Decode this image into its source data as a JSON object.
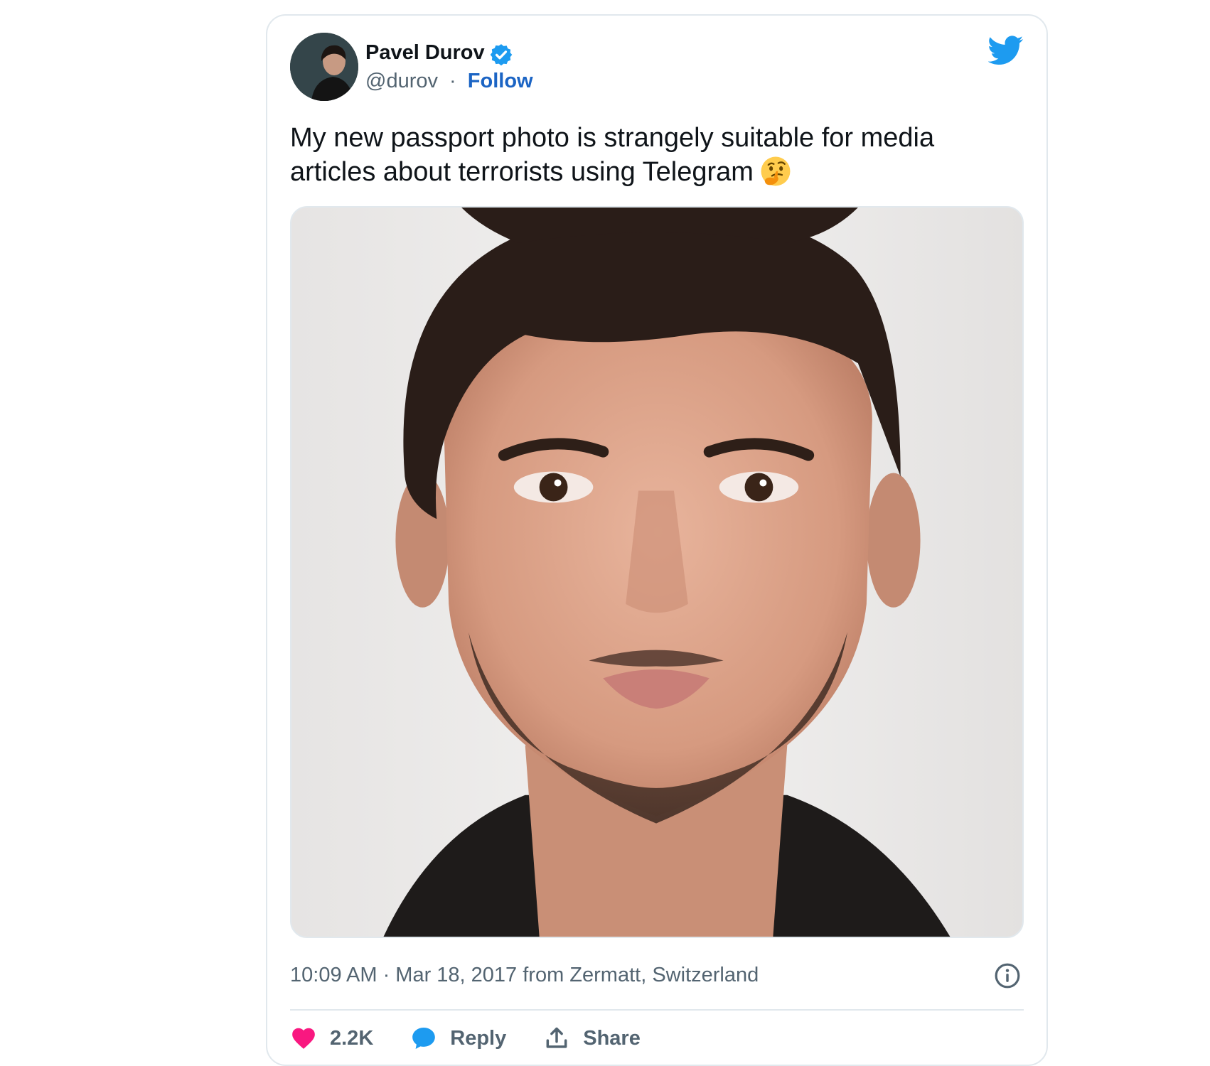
{
  "tweet": {
    "author": {
      "name": "Pavel Durov",
      "handle": "@durov",
      "follow_label": "Follow",
      "separator": "·",
      "verified": true
    },
    "text": "My new passport photo is strangely suitable for media articles about terrorists using Telegram",
    "text_emoji": "thinking-face",
    "media": {
      "kind": "photo"
    },
    "timestamp": "10:09 AM · Mar 18, 2017 from Zermatt, Switzerland",
    "actions": {
      "like_count": "2.2K",
      "reply_label": "Reply",
      "share_label": "Share"
    }
  },
  "icons": {
    "brand": "twitter-bird-icon",
    "verified": "verified-badge-icon",
    "info": "info-icon",
    "like": "heart-icon",
    "reply": "speech-bubble-icon",
    "share": "share-upload-icon"
  },
  "colors": {
    "brand_blue": "#1d9bf0",
    "link_blue": "#1b64c4",
    "like_pink": "#f91880",
    "text_dark": "#0f1419",
    "text_muted": "#536471",
    "border": "#e1e8ed"
  }
}
